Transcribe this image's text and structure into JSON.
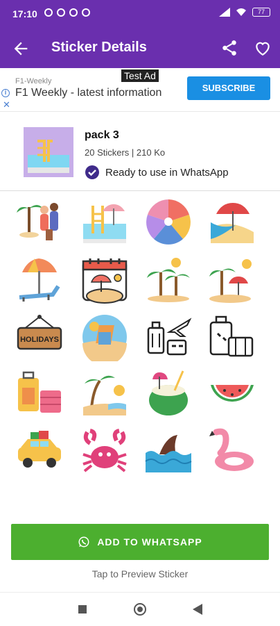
{
  "status": {
    "time": "17:10",
    "battery": "77"
  },
  "appbar": {
    "title": "Sticker Details"
  },
  "ad": {
    "tag": "Test Ad",
    "advertiser": "F1-Weekly",
    "headline": "F1 Weekly - latest information",
    "cta": "SUBSCRIBE"
  },
  "pack": {
    "name": "pack 3",
    "meta": "20 Stickers | 210 Ko",
    "ready": "Ready to use in WhatsApp"
  },
  "actions": {
    "add_label": "ADD TO WHATSAPP",
    "preview_hint": "Tap to Preview Sticker"
  },
  "stickers": [
    {
      "icon": "couple-palm-icon"
    },
    {
      "icon": "pool-ladder-icon"
    },
    {
      "icon": "beach-ball-icon"
    },
    {
      "icon": "beach-umbrella-shore-icon"
    },
    {
      "icon": "sunbed-umbrella-icon"
    },
    {
      "icon": "calendar-beach-icon"
    },
    {
      "icon": "palm-trees-sun-icon"
    },
    {
      "icon": "island-palm-icon"
    },
    {
      "icon": "holidays-sign-icon"
    },
    {
      "icon": "beach-chair-icon"
    },
    {
      "icon": "luggage-plane-icon"
    },
    {
      "icon": "suitcases-icon"
    },
    {
      "icon": "colorful-suitcases-icon"
    },
    {
      "icon": "palm-beach-sun-icon"
    },
    {
      "icon": "coconut-drink-icon"
    },
    {
      "icon": "watermelon-icon"
    },
    {
      "icon": "car-luggage-icon"
    },
    {
      "icon": "crab-icon"
    },
    {
      "icon": "shark-fin-icon"
    },
    {
      "icon": "flamingo-float-icon"
    }
  ]
}
